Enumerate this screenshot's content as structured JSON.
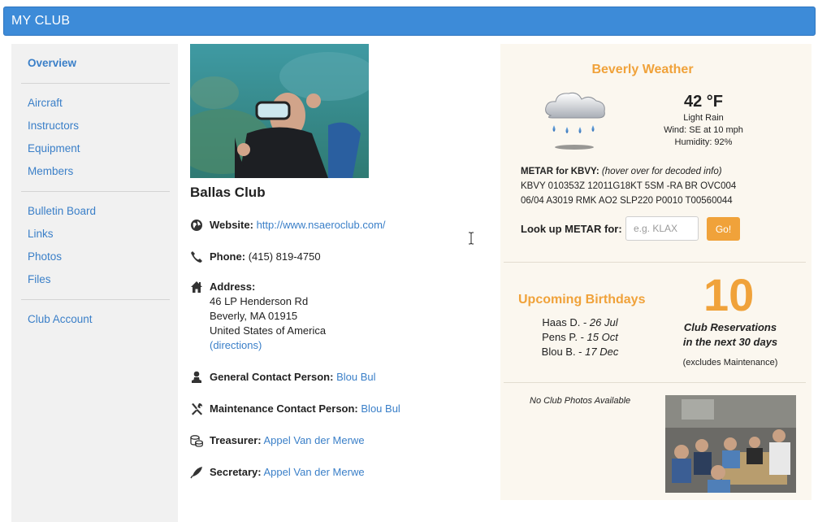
{
  "header": {
    "title": "MY CLUB"
  },
  "sidebar": {
    "items": [
      {
        "label": "Overview"
      },
      {
        "label": "Aircraft"
      },
      {
        "label": "Instructors"
      },
      {
        "label": "Equipment"
      },
      {
        "label": "Members"
      },
      {
        "label": "Bulletin Board"
      },
      {
        "label": "Links"
      },
      {
        "label": "Photos"
      },
      {
        "label": "Files"
      },
      {
        "label": "Club Account"
      }
    ]
  },
  "club": {
    "name": "Ballas Club",
    "website_label": "Website:",
    "website": "http://www.nsaeroclub.com/",
    "phone_label": "Phone:",
    "phone": "(415) 819-4750",
    "address_label": "Address:",
    "address_line1": "46 LP Henderson Rd",
    "address_line2": "Beverly, MA 01915",
    "address_line3": "United States of America",
    "directions": "(directions)",
    "general_contact_label": "General Contact Person:",
    "general_contact": "Blou Bul",
    "maintenance_contact_label": "Maintenance Contact Person:",
    "maintenance_contact": "Blou Bul",
    "treasurer_label": "Treasurer:",
    "treasurer": "Appel Van der Merwe",
    "secretary_label": "Secretary:",
    "secretary": "Appel Van der Merwe"
  },
  "weather": {
    "title": "Beverly Weather",
    "temperature": "42 °F",
    "condition": "Light Rain",
    "wind": "Wind: SE at 10 mph",
    "humidity": "Humidity: 92%",
    "metar_label": "METAR for KBVY:",
    "metar_hint": "(hover over for decoded info)",
    "metar_line1": "KBVY 010353Z 12011G18KT 5SM -RA BR OVC004",
    "metar_line2": "06/04 A3019 RMK AO2 SLP220 P0010 T00560044",
    "lookup_label": "Look up METAR for:",
    "lookup_placeholder": "e.g. KLAX",
    "go_label": "Go!"
  },
  "birthdays": {
    "title": "Upcoming Birthdays",
    "entries": [
      {
        "name": "Haas D. - ",
        "date": "26 Jul"
      },
      {
        "name": "Pens P. - ",
        "date": "15 Oct"
      },
      {
        "name": "Blou B. - ",
        "date": "17 Dec"
      }
    ]
  },
  "reservations": {
    "count": "10",
    "label_line1": "Club Reservations",
    "label_line2": "in the next 30 days",
    "note": "(excludes Maintenance)"
  },
  "photos": {
    "empty_text": "No Club Photos Available"
  },
  "colors": {
    "accent": "#3d8bd8",
    "orange": "#f0a23a",
    "link": "#3a7fc8"
  }
}
